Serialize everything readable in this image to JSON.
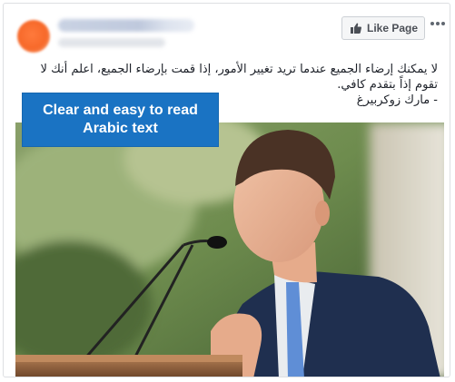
{
  "post": {
    "like_page_label": "Like Page",
    "text_lines": [
      "لا يمكنك إرضاء الجميع عندما تريد تغيير الأمور، إذا قمت بإرضاء الجميع، اعلم أنك لا",
      "تقوم إذاً بتقدم كافي.",
      "- مارك زوكربيرغ"
    ]
  },
  "caption": {
    "line1": "Clear and easy to read",
    "line2": "Arabic text"
  },
  "icons": {
    "like_button_icon": "thumbs-up-icon",
    "menu_icon": "more-horizontal-icon"
  },
  "colors": {
    "caption_background": "#1a73c3",
    "page_avatar": "#f7692a"
  }
}
